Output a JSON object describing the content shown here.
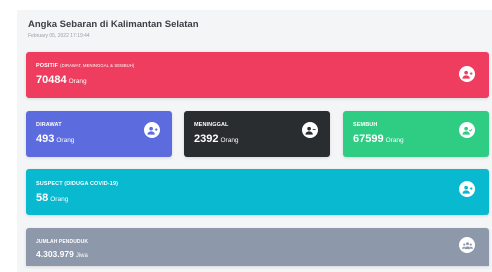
{
  "header": {
    "title": "Angka Sebaran di Kalimantan Selatan",
    "timestamp": "February 05, 2022 17:19:44"
  },
  "cards": {
    "positif": {
      "label": "POSITIF",
      "sublabel": "(DIRAWAT, MENINGGAL & SEMBUH)",
      "value": "70484",
      "unit": "Orang",
      "color": "#ee3d5e",
      "icon": "user-plus-icon"
    },
    "dirawat": {
      "label": "DIRAWAT",
      "value": "493",
      "unit": "Orang",
      "color": "#5c6bde",
      "icon": "user-plus-icon"
    },
    "meninggal": {
      "label": "MENINGGAL",
      "value": "2392",
      "unit": "Orang",
      "color": "#2a2d30",
      "icon": "user-minus-icon"
    },
    "sembuh": {
      "label": "SEMBUH",
      "value": "67599",
      "unit": "Orang",
      "color": "#2fcc84",
      "icon": "user-check-icon"
    },
    "suspect": {
      "label": "SUSPECT (DIDUGA COVID-19)",
      "value": "58",
      "unit": "Orang",
      "color": "#08b9cf",
      "icon": "user-plus-icon"
    },
    "penduduk": {
      "label": "JUMLAH PENDUDUK",
      "value": "4.303.979",
      "unit": "Jiwa",
      "color": "#8d98aa",
      "icon": "users-icon"
    }
  }
}
